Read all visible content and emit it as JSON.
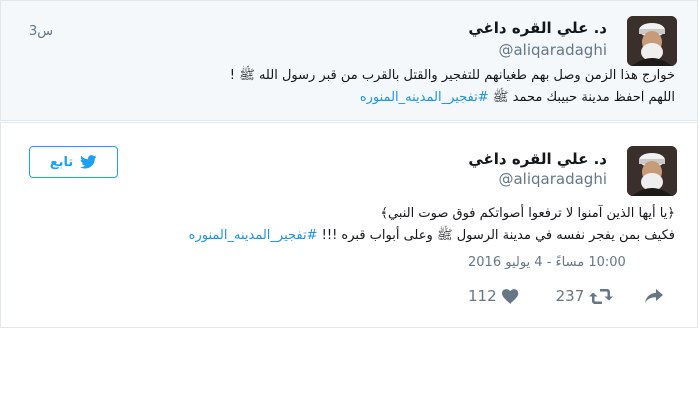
{
  "tweets": [
    {
      "name": "د. علي القره داغي",
      "handle": "@aliqaradaghi",
      "time": "3س",
      "line1": "خوارج هذا الزمن وصل بهم طغيانهم للتفجير والقتل بالقرب من قبر رسول الله ﷺ !",
      "line2_text": "اللهم احفظ مدينة حبيبك محمد ﷺ",
      "line2_hashtag": "#تفجير_المدينه_المنوره"
    },
    {
      "name": "د. علي القره داغي",
      "handle": "@aliqaradaghi",
      "follow_label": "تابع",
      "line1": "﴿يا أيها الذين آمنوا لا ترفعوا أصواتكم فوق صوت النبي﴾",
      "line2_text": "فكيف بمن يفجر نفسه في مدينة الرسول ﷺ وعلى أبواب قبره !!!",
      "line2_hashtag": "#تفجير_المدينه_المنوره",
      "datetime": "10:00 مساءً - 4 يوليو 2016",
      "retweets": "237",
      "likes": "112"
    }
  ],
  "icons": {
    "reply": "reply-icon",
    "retweet": "retweet-icon",
    "like": "heart-icon",
    "follow": "twitter-bird-icon"
  },
  "colors": {
    "link": "#1b95e0",
    "accent": "#1da1f2",
    "muted": "#657786",
    "highlight_bg": "#f5f8fa"
  }
}
